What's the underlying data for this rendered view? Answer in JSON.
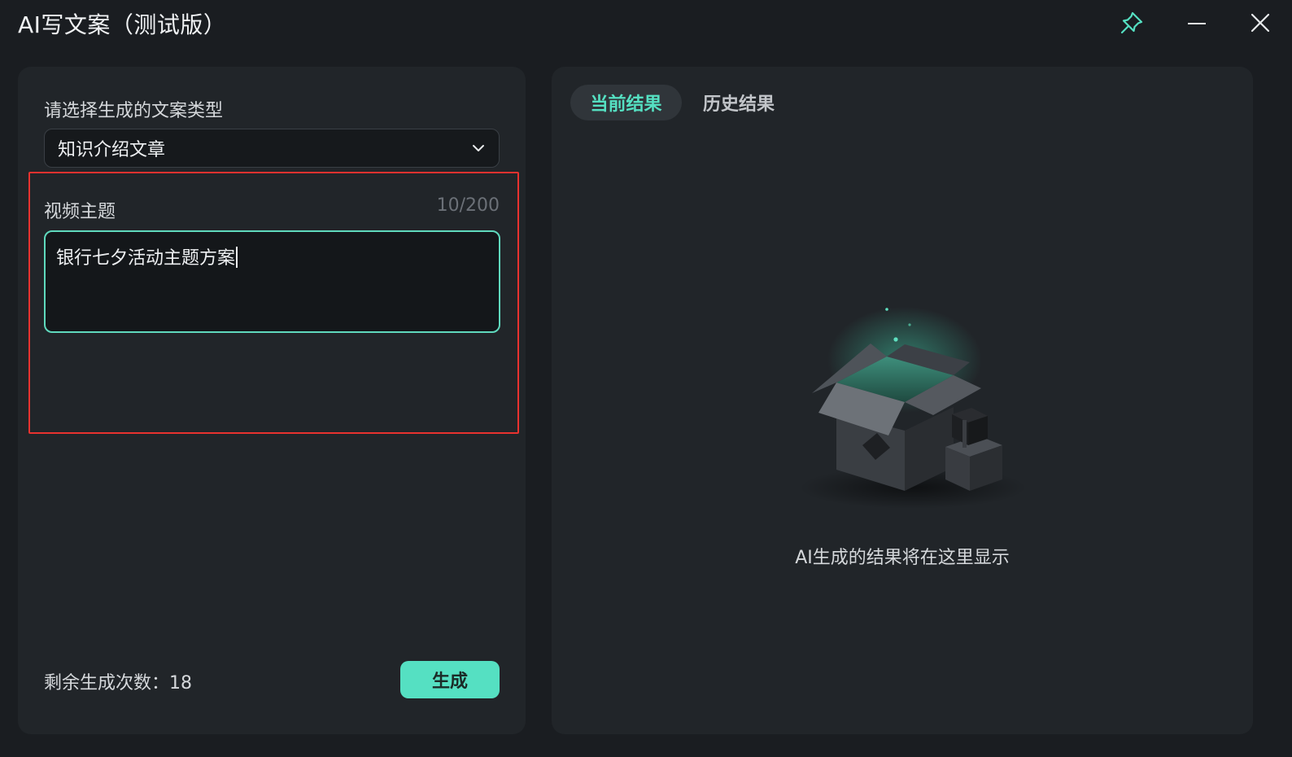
{
  "window": {
    "title": "AI写文案（测试版）"
  },
  "form": {
    "type_label": "请选择生成的文案类型",
    "type_value": "知识介绍文章",
    "topic_label": "视频主题",
    "topic_counter": "10/200",
    "topic_value": "银行七夕活动主题方案",
    "remaining_label": "剩余生成次数：18",
    "generate_label": "生成"
  },
  "results": {
    "tabs": [
      {
        "label": "当前结果",
        "active": true
      },
      {
        "label": "历史结果",
        "active": false
      }
    ],
    "empty_message": "AI生成的结果将在这里显示"
  },
  "colors": {
    "accent": "#55e0c2",
    "highlight": "#e8322f",
    "panel": "#212529",
    "background": "#1a1d21"
  },
  "icons": [
    "pin-icon",
    "minimize-icon",
    "close-icon",
    "chevron-down-icon",
    "empty-box-illustration"
  ]
}
